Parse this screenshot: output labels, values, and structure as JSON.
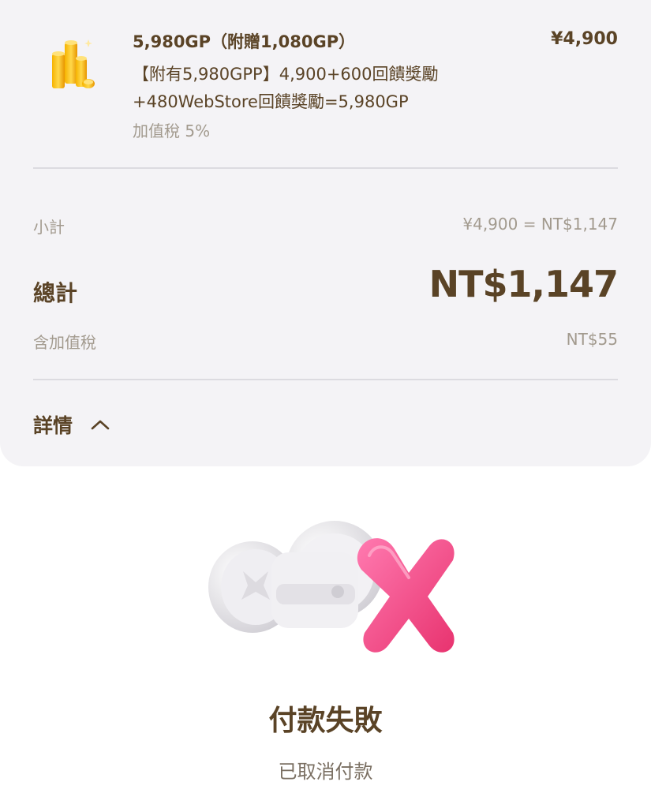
{
  "order": {
    "product_title": "5,980GP（附贈1,080GP）",
    "product_price": "¥4,900",
    "product_desc_line1": "【附有5,980GPP】4,900+600回饋獎勵",
    "product_desc_line2": "+480WebStore回饋獎勵=5,980GP",
    "product_tax": "加值稅 5%",
    "product_icon": "gold-coins-icon"
  },
  "summary": {
    "subtotal_label": "小計",
    "subtotal_value": "¥4,900 = NT$1,147",
    "total_label": "總計",
    "total_value": "NT$1,147",
    "tax_label": "含加值稅",
    "tax_value": "NT$55",
    "details_label": "詳情",
    "details_icon": "chevron-up-icon"
  },
  "status": {
    "title": "付款失敗",
    "subtitle": "已取消付款",
    "icon": "payment-failed-icon",
    "accent_color": "#f0468a"
  }
}
